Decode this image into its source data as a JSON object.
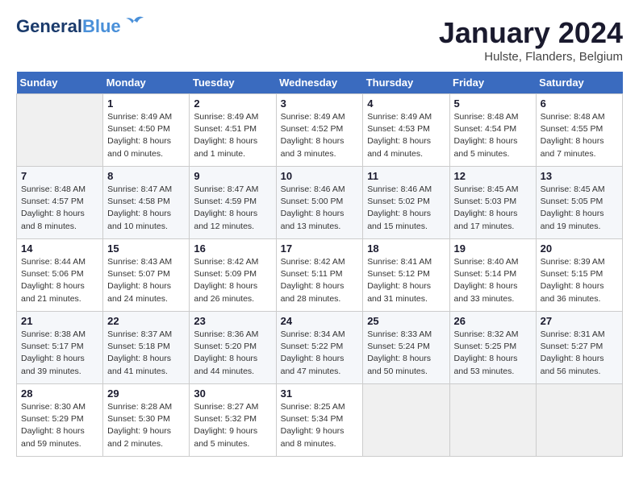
{
  "header": {
    "logo_general": "General",
    "logo_blue": "Blue",
    "month": "January 2024",
    "location": "Hulste, Flanders, Belgium"
  },
  "days_of_week": [
    "Sunday",
    "Monday",
    "Tuesday",
    "Wednesday",
    "Thursday",
    "Friday",
    "Saturday"
  ],
  "weeks": [
    [
      {
        "day": "",
        "detail": ""
      },
      {
        "day": "1",
        "detail": "Sunrise: 8:49 AM\nSunset: 4:50 PM\nDaylight: 8 hours\nand 0 minutes."
      },
      {
        "day": "2",
        "detail": "Sunrise: 8:49 AM\nSunset: 4:51 PM\nDaylight: 8 hours\nand 1 minute."
      },
      {
        "day": "3",
        "detail": "Sunrise: 8:49 AM\nSunset: 4:52 PM\nDaylight: 8 hours\nand 3 minutes."
      },
      {
        "day": "4",
        "detail": "Sunrise: 8:49 AM\nSunset: 4:53 PM\nDaylight: 8 hours\nand 4 minutes."
      },
      {
        "day": "5",
        "detail": "Sunrise: 8:48 AM\nSunset: 4:54 PM\nDaylight: 8 hours\nand 5 minutes."
      },
      {
        "day": "6",
        "detail": "Sunrise: 8:48 AM\nSunset: 4:55 PM\nDaylight: 8 hours\nand 7 minutes."
      }
    ],
    [
      {
        "day": "7",
        "detail": "Sunrise: 8:48 AM\nSunset: 4:57 PM\nDaylight: 8 hours\nand 8 minutes."
      },
      {
        "day": "8",
        "detail": "Sunrise: 8:47 AM\nSunset: 4:58 PM\nDaylight: 8 hours\nand 10 minutes."
      },
      {
        "day": "9",
        "detail": "Sunrise: 8:47 AM\nSunset: 4:59 PM\nDaylight: 8 hours\nand 12 minutes."
      },
      {
        "day": "10",
        "detail": "Sunrise: 8:46 AM\nSunset: 5:00 PM\nDaylight: 8 hours\nand 13 minutes."
      },
      {
        "day": "11",
        "detail": "Sunrise: 8:46 AM\nSunset: 5:02 PM\nDaylight: 8 hours\nand 15 minutes."
      },
      {
        "day": "12",
        "detail": "Sunrise: 8:45 AM\nSunset: 5:03 PM\nDaylight: 8 hours\nand 17 minutes."
      },
      {
        "day": "13",
        "detail": "Sunrise: 8:45 AM\nSunset: 5:05 PM\nDaylight: 8 hours\nand 19 minutes."
      }
    ],
    [
      {
        "day": "14",
        "detail": "Sunrise: 8:44 AM\nSunset: 5:06 PM\nDaylight: 8 hours\nand 21 minutes."
      },
      {
        "day": "15",
        "detail": "Sunrise: 8:43 AM\nSunset: 5:07 PM\nDaylight: 8 hours\nand 24 minutes."
      },
      {
        "day": "16",
        "detail": "Sunrise: 8:42 AM\nSunset: 5:09 PM\nDaylight: 8 hours\nand 26 minutes."
      },
      {
        "day": "17",
        "detail": "Sunrise: 8:42 AM\nSunset: 5:11 PM\nDaylight: 8 hours\nand 28 minutes."
      },
      {
        "day": "18",
        "detail": "Sunrise: 8:41 AM\nSunset: 5:12 PM\nDaylight: 8 hours\nand 31 minutes."
      },
      {
        "day": "19",
        "detail": "Sunrise: 8:40 AM\nSunset: 5:14 PM\nDaylight: 8 hours\nand 33 minutes."
      },
      {
        "day": "20",
        "detail": "Sunrise: 8:39 AM\nSunset: 5:15 PM\nDaylight: 8 hours\nand 36 minutes."
      }
    ],
    [
      {
        "day": "21",
        "detail": "Sunrise: 8:38 AM\nSunset: 5:17 PM\nDaylight: 8 hours\nand 39 minutes."
      },
      {
        "day": "22",
        "detail": "Sunrise: 8:37 AM\nSunset: 5:18 PM\nDaylight: 8 hours\nand 41 minutes."
      },
      {
        "day": "23",
        "detail": "Sunrise: 8:36 AM\nSunset: 5:20 PM\nDaylight: 8 hours\nand 44 minutes."
      },
      {
        "day": "24",
        "detail": "Sunrise: 8:34 AM\nSunset: 5:22 PM\nDaylight: 8 hours\nand 47 minutes."
      },
      {
        "day": "25",
        "detail": "Sunrise: 8:33 AM\nSunset: 5:24 PM\nDaylight: 8 hours\nand 50 minutes."
      },
      {
        "day": "26",
        "detail": "Sunrise: 8:32 AM\nSunset: 5:25 PM\nDaylight: 8 hours\nand 53 minutes."
      },
      {
        "day": "27",
        "detail": "Sunrise: 8:31 AM\nSunset: 5:27 PM\nDaylight: 8 hours\nand 56 minutes."
      }
    ],
    [
      {
        "day": "28",
        "detail": "Sunrise: 8:30 AM\nSunset: 5:29 PM\nDaylight: 8 hours\nand 59 minutes."
      },
      {
        "day": "29",
        "detail": "Sunrise: 8:28 AM\nSunset: 5:30 PM\nDaylight: 9 hours\nand 2 minutes."
      },
      {
        "day": "30",
        "detail": "Sunrise: 8:27 AM\nSunset: 5:32 PM\nDaylight: 9 hours\nand 5 minutes."
      },
      {
        "day": "31",
        "detail": "Sunrise: 8:25 AM\nSunset: 5:34 PM\nDaylight: 9 hours\nand 8 minutes."
      },
      {
        "day": "",
        "detail": ""
      },
      {
        "day": "",
        "detail": ""
      },
      {
        "day": "",
        "detail": ""
      }
    ]
  ]
}
